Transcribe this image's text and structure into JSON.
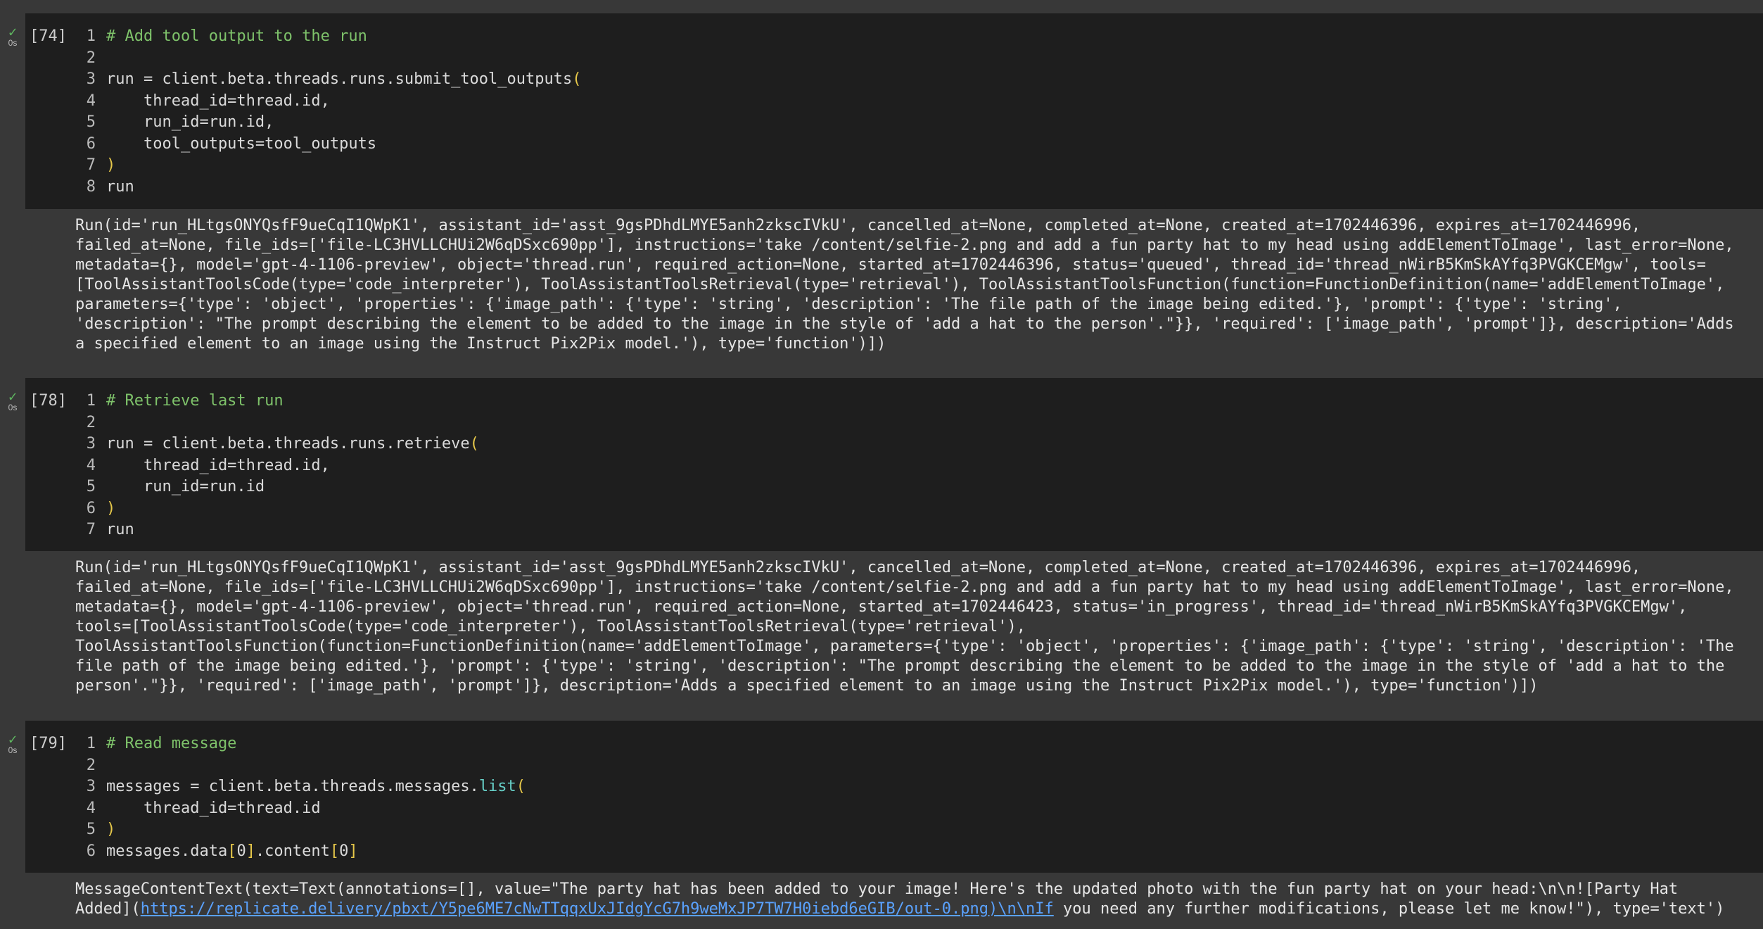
{
  "cells": [
    {
      "exec_count": "[74]",
      "status_time": "0s",
      "lines": [
        {
          "n": "1",
          "html": "comment",
          "text": "# Add tool output to the run"
        },
        {
          "n": "2",
          "text": ""
        },
        {
          "n": "3",
          "parts": [
            "run = client.beta.threads.runs.submit_tool_outputs",
            "("
          ]
        },
        {
          "n": "4",
          "text": "    thread_id=thread.id,"
        },
        {
          "n": "5",
          "text": "    run_id=run.id,"
        },
        {
          "n": "6",
          "text": "    tool_outputs=tool_outputs"
        },
        {
          "n": "7",
          "paren": ")"
        },
        {
          "n": "8",
          "text": "run"
        }
      ],
      "output": "Run(id='run_HLtgsONYQsfF9ueCqI1QWpK1', assistant_id='asst_9gsPDhdLMYE5anh2zkscIVkU', cancelled_at=None, completed_at=None, created_at=1702446396, expires_at=1702446996,\nfailed_at=None, file_ids=['file-LC3HVLLCHUi2W6qDSxc690pp'], instructions='take /content/selfie-2.png and add a fun party hat to my head using addElementToImage', last_error=None,\nmetadata={}, model='gpt-4-1106-preview', object='thread.run', required_action=None, started_at=1702446396, status='queued', thread_id='thread_nWirB5KmSkAYfq3PVGKCEMgw', tools=\n[ToolAssistantToolsCode(type='code_interpreter'), ToolAssistantToolsRetrieval(type='retrieval'), ToolAssistantToolsFunction(function=FunctionDefinition(name='addElementToImage',\nparameters={'type': 'object', 'properties': {'image_path': {'type': 'string', 'description': 'The file path of the image being edited.'}, 'prompt': {'type': 'string',\n'description': \"The prompt describing the element to be added to the image in the style of 'add a hat to the person'.\"}}, 'required': ['image_path', 'prompt']}, description='Adds\na specified element to an image using the Instruct Pix2Pix model.'), type='function')])"
    },
    {
      "exec_count": "[78]",
      "status_time": "0s",
      "lines": [
        {
          "n": "1",
          "html": "comment",
          "text": "# Retrieve last run"
        },
        {
          "n": "2",
          "text": ""
        },
        {
          "n": "3",
          "parts": [
            "run = client.beta.threads.runs.retrieve",
            "("
          ]
        },
        {
          "n": "4",
          "text": "    thread_id=thread.id,"
        },
        {
          "n": "5",
          "text": "    run_id=run.id"
        },
        {
          "n": "6",
          "paren": ")"
        },
        {
          "n": "7",
          "text": "run"
        }
      ],
      "output": "Run(id='run_HLtgsONYQsfF9ueCqI1QWpK1', assistant_id='asst_9gsPDhdLMYE5anh2zkscIVkU', cancelled_at=None, completed_at=None, created_at=1702446396, expires_at=1702446996,\nfailed_at=None, file_ids=['file-LC3HVLLCHUi2W6qDSxc690pp'], instructions='take /content/selfie-2.png and add a fun party hat to my head using addElementToImage', last_error=None,\nmetadata={}, model='gpt-4-1106-preview', object='thread.run', required_action=None, started_at=1702446423, status='in_progress', thread_id='thread_nWirB5KmSkAYfq3PVGKCEMgw',\ntools=[ToolAssistantToolsCode(type='code_interpreter'), ToolAssistantToolsRetrieval(type='retrieval'),\nToolAssistantToolsFunction(function=FunctionDefinition(name='addElementToImage', parameters={'type': 'object', 'properties': {'image_path': {'type': 'string', 'description': 'The\nfile path of the image being edited.'}, 'prompt': {'type': 'string', 'description': \"The prompt describing the element to be added to the image in the style of 'add a hat to the\nperson'.\"}}, 'required': ['image_path', 'prompt']}, description='Adds a specified element to an image using the Instruct Pix2Pix model.'), type='function')])"
    },
    {
      "exec_count": "[79]",
      "status_time": "0s",
      "lines": [
        {
          "n": "1",
          "html": "comment",
          "text": "# Read message"
        },
        {
          "n": "2",
          "text": ""
        },
        {
          "n": "3",
          "parts3": [
            "messages = client.beta.threads.messages.",
            "list",
            "("
          ]
        },
        {
          "n": "4",
          "text": "    thread_id=thread.id"
        },
        {
          "n": "5",
          "paren": ")"
        },
        {
          "n": "6",
          "parts4": [
            "messages.data",
            "[",
            "0",
            "]",
            ".content",
            "[",
            "0",
            "]"
          ]
        }
      ],
      "output_pre": "MessageContentText(text=Text(annotations=[], value=\"The party hat has been added to your image! Here's the updated photo with the fun party hat on your head:\\n\\n![Party Hat\nAdded](",
      "output_link": "https://replicate.delivery/pbxt/Y5pe6ME7cNwTTqqxUxJIdgYcG7h9weMxJP7TW7H0iebd6eGIB/out-0.png)\\n\\nIf",
      "output_post": " you need any further modifications, please let me know!\"), type='text')"
    }
  ]
}
